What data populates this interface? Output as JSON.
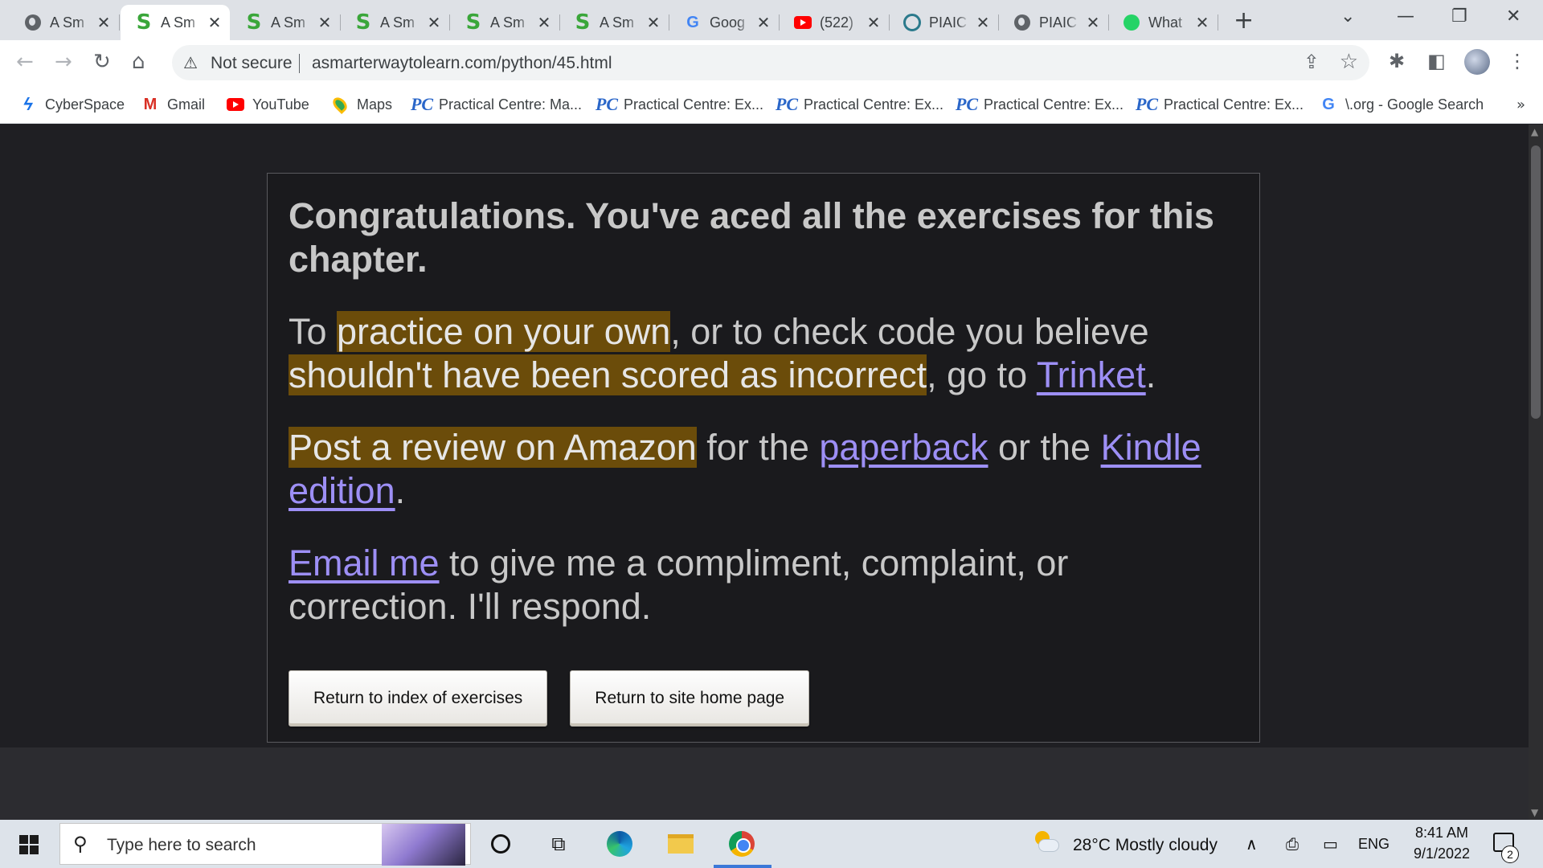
{
  "browser": {
    "tabs": [
      {
        "label": "A Sm",
        "icon": "globe-icon",
        "active": false
      },
      {
        "label": "A Sm",
        "icon": "s-site-icon",
        "active": true
      },
      {
        "label": "A Sm",
        "icon": "s-site-icon",
        "active": false
      },
      {
        "label": "A Sm",
        "icon": "s-site-icon",
        "active": false
      },
      {
        "label": "A Sm",
        "icon": "s-site-icon",
        "active": false
      },
      {
        "label": "A Sm",
        "icon": "s-site-icon",
        "active": false
      },
      {
        "label": "Goog",
        "icon": "google-icon",
        "active": false
      },
      {
        "label": "(522)",
        "icon": "youtube-icon",
        "active": false
      },
      {
        "label": "PIAIC",
        "icon": "piaic-icon",
        "active": false
      },
      {
        "label": "PIAIC",
        "icon": "globe-icon",
        "active": false
      },
      {
        "label": "What",
        "icon": "whatsapp-icon",
        "active": false
      }
    ],
    "close_glyph": "✕",
    "new_tab_glyph": "+",
    "address": {
      "security_label": "Not secure",
      "url": "asmarterwaytolearn.com/python/45.html"
    },
    "bookmarks": [
      {
        "label": "CyberSpace",
        "icon": "cyberspace-icon"
      },
      {
        "label": "Gmail",
        "icon": "gmail-icon"
      },
      {
        "label": "YouTube",
        "icon": "youtube-icon"
      },
      {
        "label": "Maps",
        "icon": "maps-icon"
      },
      {
        "label": "Practical Centre: Ma...",
        "icon": "pc-icon"
      },
      {
        "label": "Practical Centre: Ex...",
        "icon": "pc-icon"
      },
      {
        "label": "Practical Centre: Ex...",
        "icon": "pc-icon"
      },
      {
        "label": "Practical Centre: Ex...",
        "icon": "pc-icon"
      },
      {
        "label": "Practical Centre: Ex...",
        "icon": "pc-icon"
      },
      {
        "label": "\\.org - Google Search",
        "icon": "google-icon"
      }
    ],
    "bookmarks_more": "»"
  },
  "page": {
    "heading": "Congratulations. You've aced all the exercises for this chapter.",
    "p1": {
      "pre": "To ",
      "hl1": "practice on your own",
      "mid": ", or to check code you believe ",
      "hl2": "shouldn't have been scored as incorrect",
      "mid2": ", go to ",
      "link": "Trinket",
      "post": "."
    },
    "p2": {
      "hl": "Post a review on Amazon",
      "mid": " for the ",
      "link1": "paperback",
      "mid2": " or the ",
      "link2": "Kindle edition",
      "post": "."
    },
    "p3": {
      "link": "Email me",
      "rest": " to give me a compliment, complaint, or correction. I'll respond."
    },
    "buttons": {
      "index": "Return to index of exercises",
      "home": "Return to site home page"
    },
    "colors": {
      "highlight": "#6b4c0a",
      "link": "#9d8ff5",
      "text": "#c8c8c8",
      "background": "#1f1f23"
    }
  },
  "taskbar": {
    "search_placeholder": "Type here to search",
    "weather": "28°C  Mostly cloudy",
    "language": "ENG",
    "time": "8:41 AM",
    "date": "9/1/2022",
    "notifications": "2"
  }
}
